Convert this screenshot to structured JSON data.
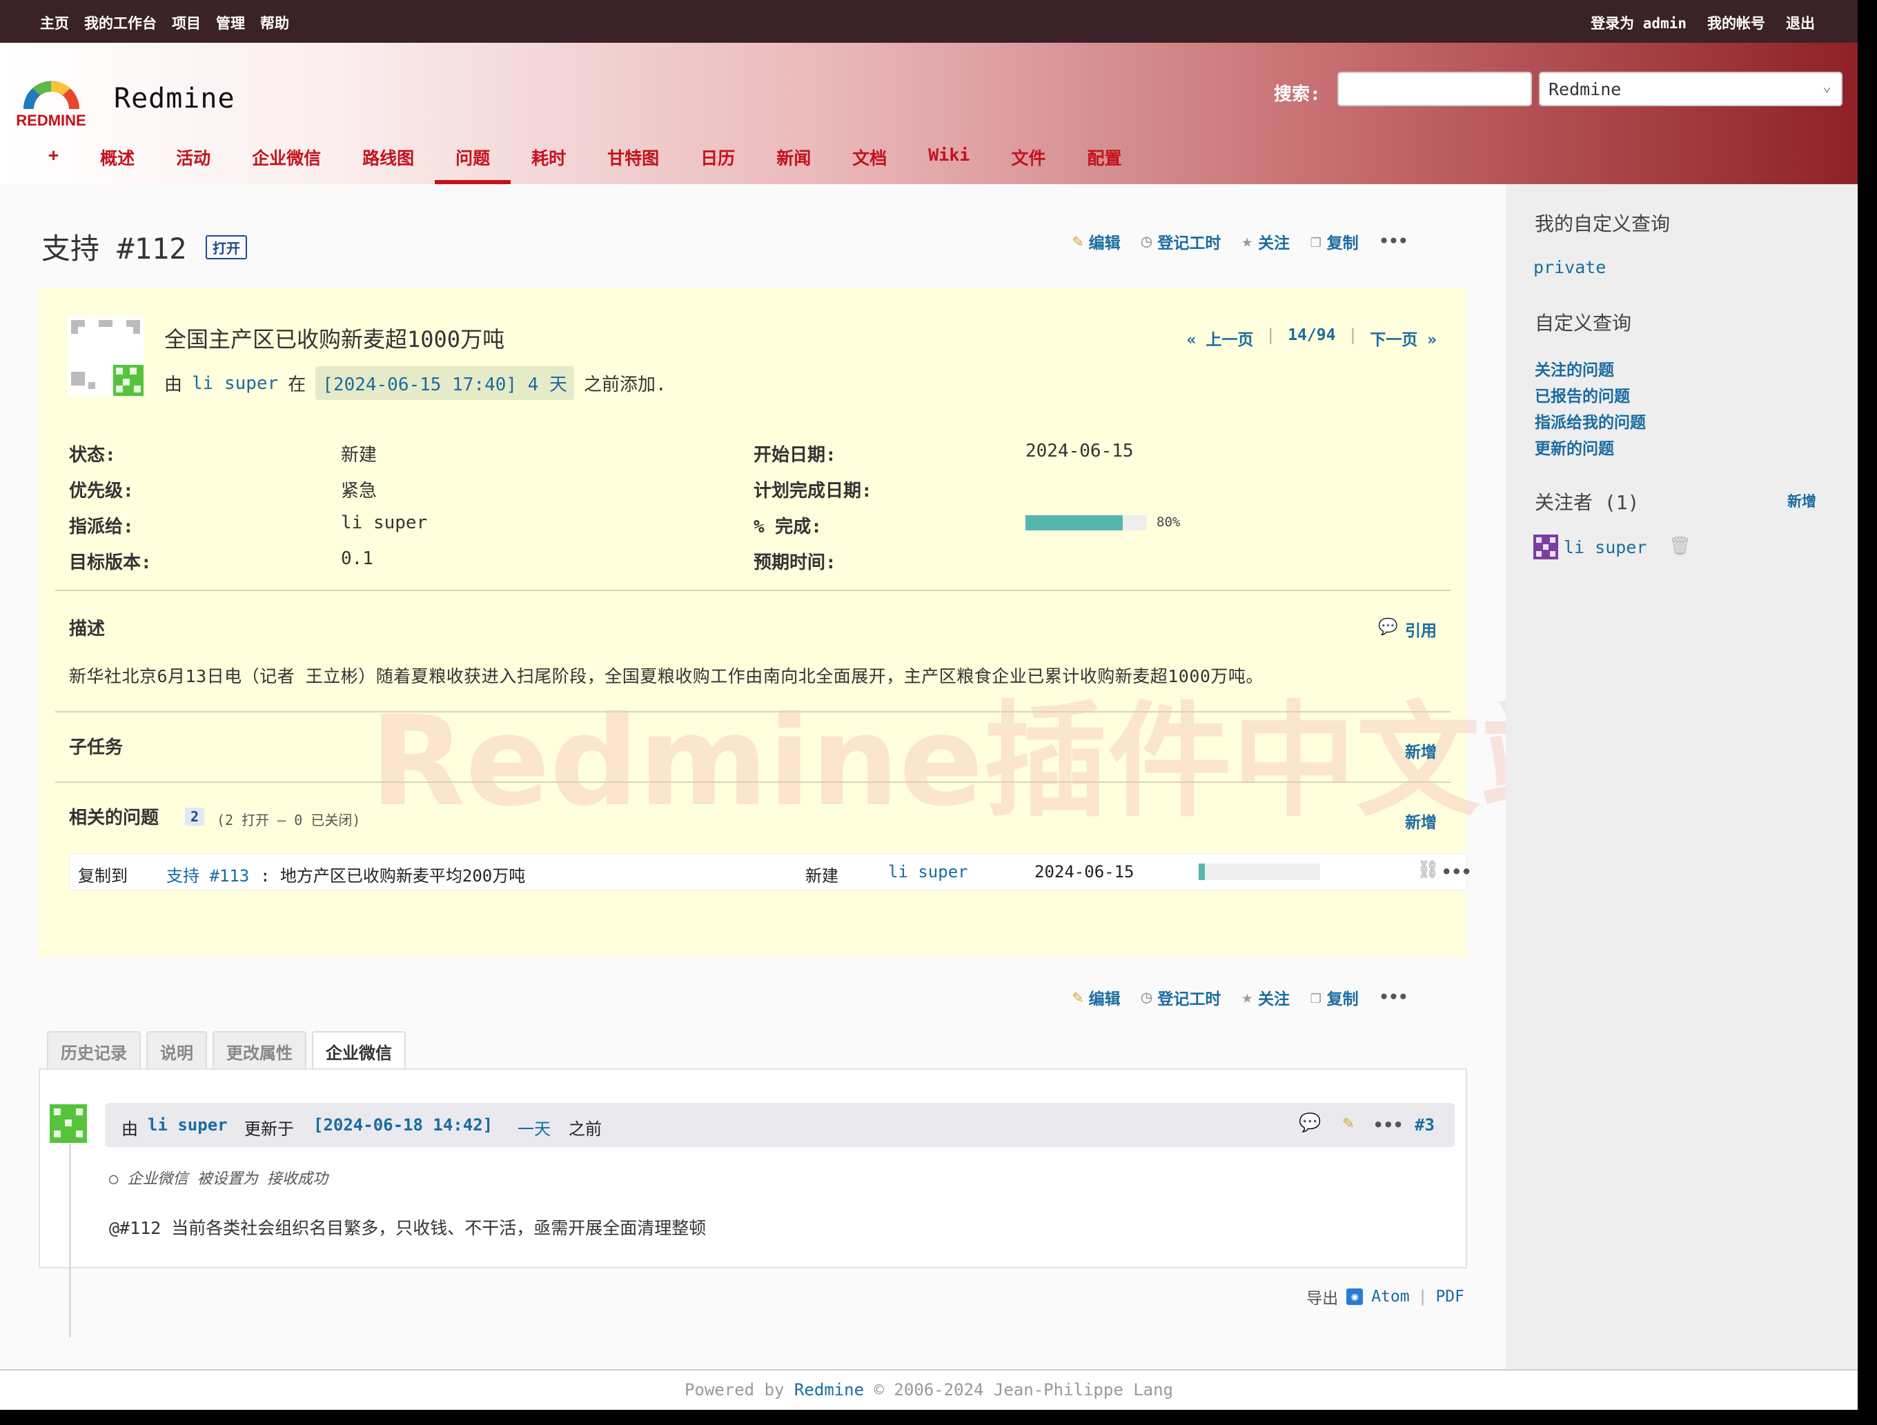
{
  "topmenu": {
    "left": [
      "主页",
      "我的工作台",
      "项目",
      "管理",
      "帮助"
    ],
    "logged_in_prefix": "登录为",
    "user": "admin",
    "my_account": "我的帐号",
    "logout": "退出"
  },
  "header": {
    "title": "Redmine",
    "logo_text": "REDMINE",
    "search_label": "搜索:",
    "search_value": "",
    "project_select": "Redmine",
    "new_object": "+",
    "tabs": [
      "概述",
      "活动",
      "企业微信",
      "路线图",
      "问题",
      "耗时",
      "甘特图",
      "日历",
      "新闻",
      "文档",
      "Wiki",
      "文件",
      "配置"
    ],
    "selected_tab": "问题"
  },
  "issue": {
    "title": "支持 #112",
    "status_badge": "打开",
    "actions": {
      "edit": "编辑",
      "log_time": "登记工时",
      "watch": "关注",
      "copy": "复制",
      "more": "•••"
    },
    "subject": "全国主产区已收购新麦超1000万吨",
    "author_prefix": "由",
    "author": "li super",
    "author_mid": "在",
    "created": "[2024-06-15 17:40] 4 天",
    "author_suffix": "之前添加.",
    "pager": {
      "prev": "« 上一页",
      "position": "14/94",
      "next": "下一页 »"
    },
    "attributes": {
      "status_label": "状态:",
      "status": "新建",
      "priority_label": "优先级:",
      "priority": "紧急",
      "assignee_label": "指派给:",
      "assignee": "li super",
      "version_label": "目标版本:",
      "version": "0.1",
      "start_label": "开始日期:",
      "start": "2024-06-15",
      "due_label": "计划完成日期:",
      "due": "",
      "done_label": "% 完成:",
      "done_text": "80%",
      "done_ratio": 0.8,
      "estimated_label": "预期时间:",
      "estimated": ""
    },
    "description_title": "描述",
    "quote": "引用",
    "description": "新华社北京6月13日电（记者 王立彬）随着夏粮收获进入扫尾阶段，全国夏粮收购工作由南向北全面展开，主产区粮食企业已累计收购新麦超1000万吨。",
    "subtasks_title": "子任务",
    "subtasks_add": "新增",
    "relations_title": "相关的问题",
    "relations_count": "2",
    "relations_summary": "(2 打开 — 0 已关闭)",
    "relations_add": "新增",
    "relation": {
      "type": "复制到",
      "issue_link": "支持 #113",
      "subject": ": 地方产区已收购新麦平均200万吨",
      "status": "新建",
      "assignee": "li super",
      "date": "2024-06-15",
      "done_ratio": 0.05
    },
    "watermark": "Redmine插件中文站"
  },
  "history": {
    "tabs": [
      "历史记录",
      "说明",
      "更改属性",
      "企业微信"
    ],
    "selected_tab": "企业微信",
    "journal": {
      "prefix": "由",
      "author": "li super",
      "mid": "更新于",
      "time": "[2024-06-18 14:42]",
      "ago": "一天",
      "suffix": "之前",
      "number": "#3",
      "detail": "企业微信 被设置为 接收成功",
      "notes": "@#112 当前各类社会组织名目繁多，只收钱、不干活，亟需开展全面清理整顿"
    }
  },
  "export": {
    "label": "导出",
    "atom": "Atom",
    "sep": "|",
    "pdf": "PDF"
  },
  "sidebar": {
    "my_queries_title": "我的自定义查询",
    "my_queries": [
      "private"
    ],
    "queries_title": "自定义查询",
    "queries": [
      "关注的问题",
      "已报告的问题",
      "指派给我的问题",
      "更新的问题"
    ],
    "watchers_title": "关注者 (1)",
    "watchers_add": "新增",
    "watchers": [
      "li super"
    ]
  },
  "footer": {
    "powered": "Powered by",
    "link": "Redmine",
    "copyright": "© 2006-2024 Jean-Philippe Lang"
  }
}
